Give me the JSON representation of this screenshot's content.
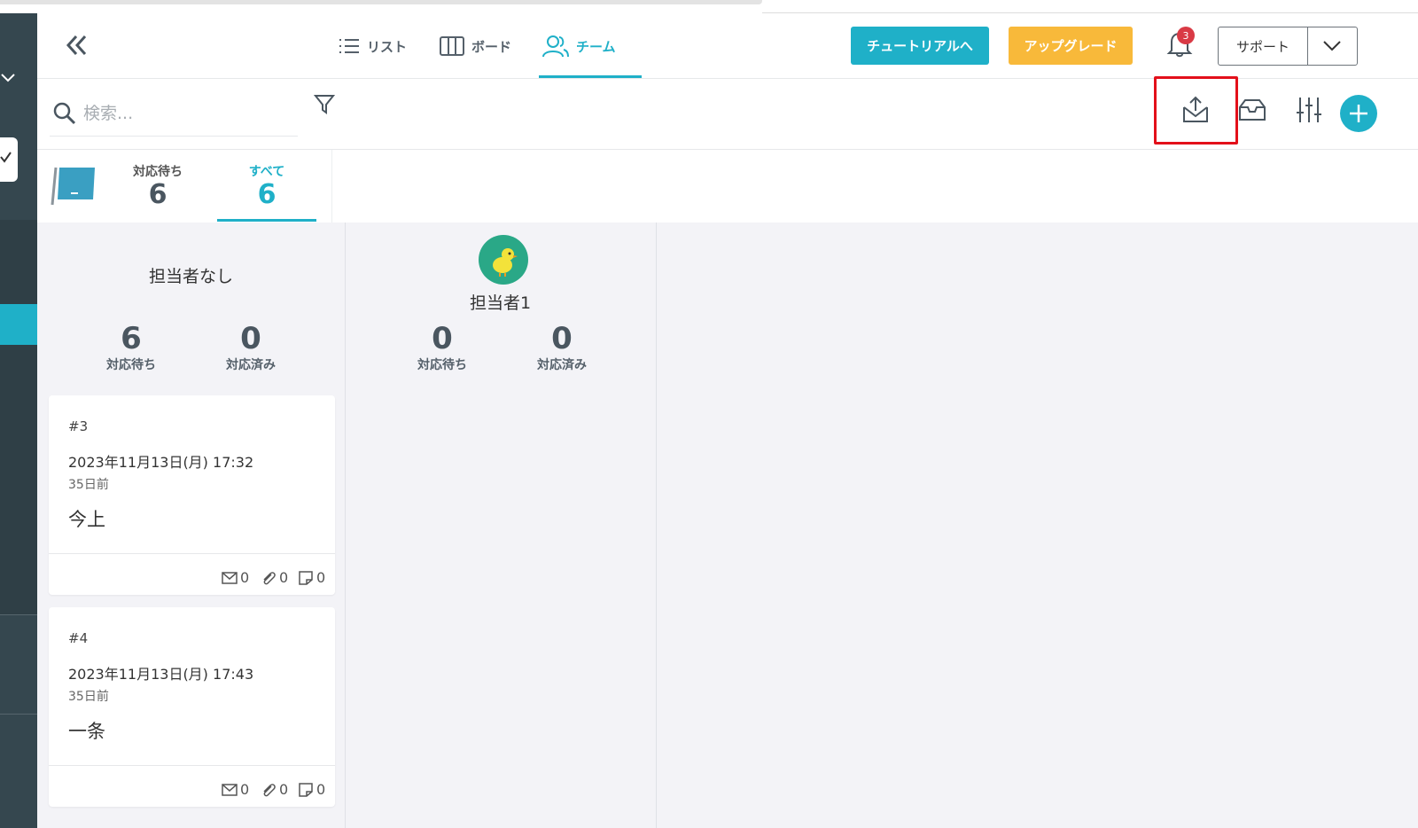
{
  "header": {
    "tabs": [
      {
        "label": "リスト",
        "icon": "list-icon"
      },
      {
        "label": "ボード",
        "icon": "board-icon"
      },
      {
        "label": "チーム",
        "icon": "team-icon",
        "active": true
      }
    ],
    "tutorial_label": "チュートリアルへ",
    "upgrade_label": "アップグレード",
    "notification_count": "3",
    "support_label": "サポート"
  },
  "toolbar": {
    "search_placeholder": "検索...",
    "icons": [
      "search-icon",
      "filter-icon",
      "export-mail-icon",
      "inbox-icon",
      "settings-sliders-icon",
      "plus-icon"
    ]
  },
  "status_tabs": [
    {
      "label": "対応待ち",
      "count": "6"
    },
    {
      "label": "すべて",
      "count": "6",
      "active": true
    }
  ],
  "columns": [
    {
      "title": "担当者なし",
      "waiting_count": "6",
      "waiting_label": "対応待ち",
      "done_count": "0",
      "done_label": "対応済み",
      "cards": [
        {
          "id": "#3",
          "date": "2023年11月13日(月) 17:32",
          "ago": "35日前",
          "title": "今上",
          "mails": "0",
          "attachments": "0",
          "notes": "0"
        },
        {
          "id": "#4",
          "date": "2023年11月13日(月) 17:43",
          "ago": "35日前",
          "title": "一条",
          "mails": "0",
          "attachments": "0",
          "notes": "0"
        }
      ]
    },
    {
      "title": "担当者1",
      "waiting_count": "0",
      "waiting_label": "対応待ち",
      "done_count": "0",
      "done_label": "対応済み",
      "cards": []
    }
  ],
  "colors": {
    "accent": "#1fb0c8",
    "upgrade": "#f8b93a",
    "highlight": "#e3101a",
    "sidebar": "#35474f"
  }
}
